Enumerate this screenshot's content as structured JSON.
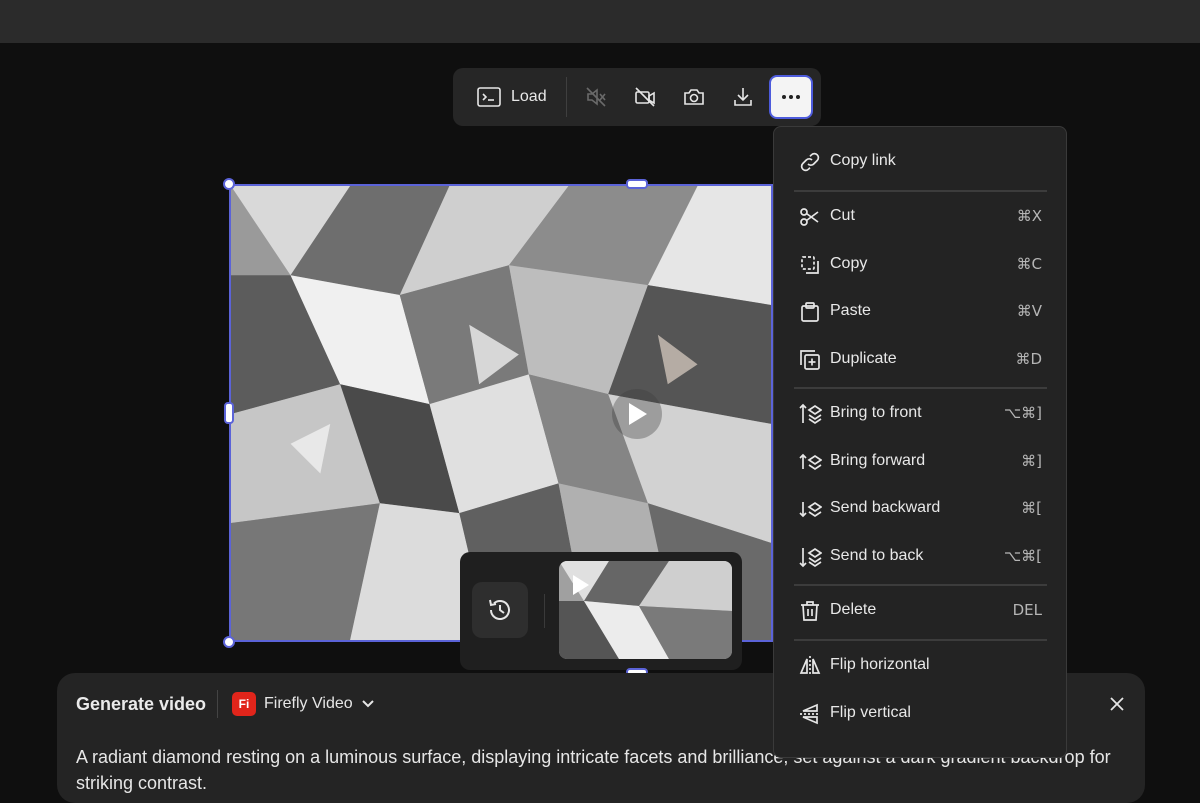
{
  "toolbar": {
    "load_label": "Load",
    "icons": [
      "terminal-icon",
      "mute-icon",
      "no-camera-icon",
      "camera-icon",
      "download-icon",
      "more-icon"
    ]
  },
  "context_menu": {
    "items": [
      {
        "label": "Copy link",
        "shortcut": "",
        "icon": "link-icon"
      },
      {
        "label": "Cut",
        "shortcut": "⌘X",
        "icon": "scissors-icon"
      },
      {
        "label": "Copy",
        "shortcut": "⌘C",
        "icon": "copy-icon"
      },
      {
        "label": "Paste",
        "shortcut": "⌘V",
        "icon": "clipboard-icon"
      },
      {
        "label": "Duplicate",
        "shortcut": "⌘D",
        "icon": "duplicate-icon"
      },
      {
        "label": "Bring to front",
        "shortcut": "⌥⌘]",
        "icon": "bring-to-front-icon"
      },
      {
        "label": "Bring forward",
        "shortcut": "⌘]",
        "icon": "bring-forward-icon"
      },
      {
        "label": "Send backward",
        "shortcut": "⌘[",
        "icon": "send-backward-icon"
      },
      {
        "label": "Send to back",
        "shortcut": "⌥⌘[",
        "icon": "send-to-back-icon"
      },
      {
        "label": "Delete",
        "shortcut": "DEL",
        "icon": "trash-icon"
      },
      {
        "label": "Flip horizontal",
        "shortcut": "",
        "icon": "flip-horizontal-icon"
      },
      {
        "label": "Flip vertical",
        "shortcut": "",
        "icon": "flip-vertical-icon"
      }
    ]
  },
  "history": {
    "icon": "history-icon"
  },
  "panel": {
    "title": "Generate video",
    "model_badge": "Fi",
    "model_name": "Firefly Video",
    "prompt": "A radiant diamond resting on a luminous surface, displaying intricate facets and brilliance, set against a dark gradient backdrop for striking contrast."
  },
  "colors": {
    "accent": "#5b63d8",
    "background": "#0f0f0f",
    "menu_bg": "#232323",
    "brand_red": "#e1251b"
  }
}
